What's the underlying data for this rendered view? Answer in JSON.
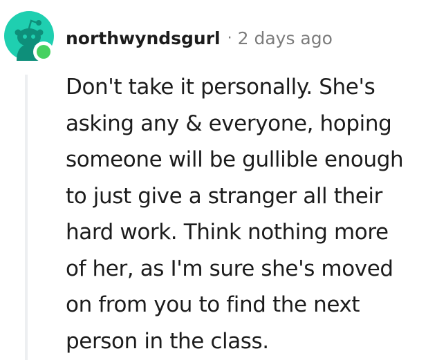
{
  "comment": {
    "username": "northwyndsgurl",
    "separator": "·",
    "timestamp": "2 days ago",
    "avatar_icon": "snoo-avatar-icon",
    "online_status": "online",
    "colors": {
      "avatar_bg": "#1fcfb0",
      "online_dot": "#46d160",
      "thread_line": "#edeff1",
      "meta_gray": "#7c7c7c",
      "text": "#1c1c1c"
    },
    "body_lines": [
      "Don't take it personally. She's",
      "asking any & everyone, hoping",
      "someone will be gullible enough",
      "to just give a stranger all their",
      "hard work. Think nothing more",
      "of her, as I'm sure she's moved",
      "on from you to find the next",
      "person in the class."
    ]
  }
}
